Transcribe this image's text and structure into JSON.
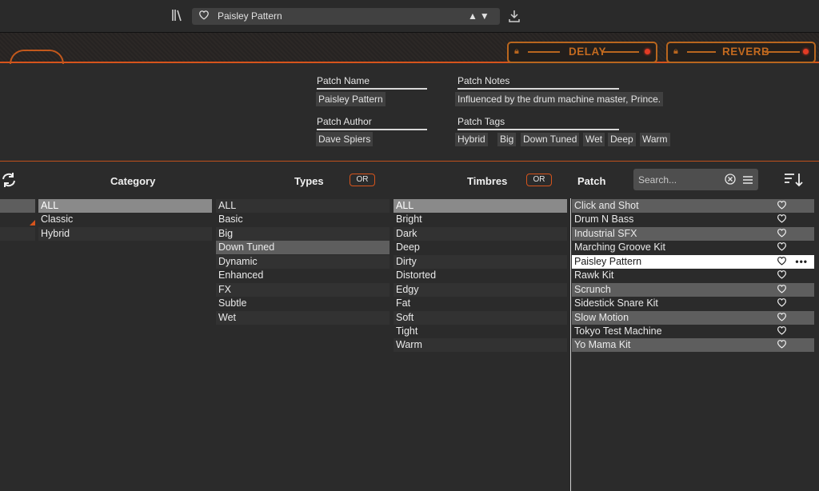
{
  "toolbar": {
    "current_patch": "Paisley Pattern"
  },
  "effects": [
    {
      "label": "DELAY",
      "led_color": "#e23b25"
    },
    {
      "label": "REVERB",
      "led_color": "#e23b25"
    }
  ],
  "patch_info": {
    "name_label": "Patch Name",
    "name_value": "Paisley Pattern",
    "author_label": "Patch Author",
    "author_value": "Dave Spiers",
    "notes_label": "Patch Notes",
    "notes_value": "Influenced by the drum machine master, Prince.",
    "tags_label": "Patch Tags",
    "tags": [
      "Hybrid",
      "Big",
      "Down Tuned",
      "Wet",
      "Deep",
      "Warm"
    ]
  },
  "browser": {
    "category_header": "Category",
    "types_header": "Types",
    "timbres_header": "Timbres",
    "patch_header": "Patch",
    "or_label": "OR",
    "search_placeholder": "Search...",
    "category_items": [
      "ALL",
      "Classic",
      "Hybrid"
    ],
    "type_items": [
      "ALL",
      "Basic",
      "Big",
      "Down Tuned",
      "Dynamic",
      "Enhanced",
      "FX",
      "Subtle",
      "Wet"
    ],
    "timbre_items": [
      "ALL",
      "Bright",
      "Dark",
      "Deep",
      "Dirty",
      "Distorted",
      "Edgy",
      "Fat",
      "Soft",
      "Tight",
      "Warm"
    ],
    "patches": [
      "Click and Shot",
      "Drum N Bass",
      "Industrial SFX",
      "Marching Groove Kit",
      "Paisley Pattern",
      "Rawk Kit",
      "Scrunch",
      "Sidestick Snare Kit",
      "Slow Motion",
      "Tokyo Test Machine",
      "Yo Mama Kit"
    ],
    "selected_patch": "Paisley Pattern",
    "selected_type": "Down Tuned"
  },
  "colors": {
    "accent": "#d6541c",
    "fx_orange": "#c36a1f",
    "background": "#2b2b2b"
  }
}
